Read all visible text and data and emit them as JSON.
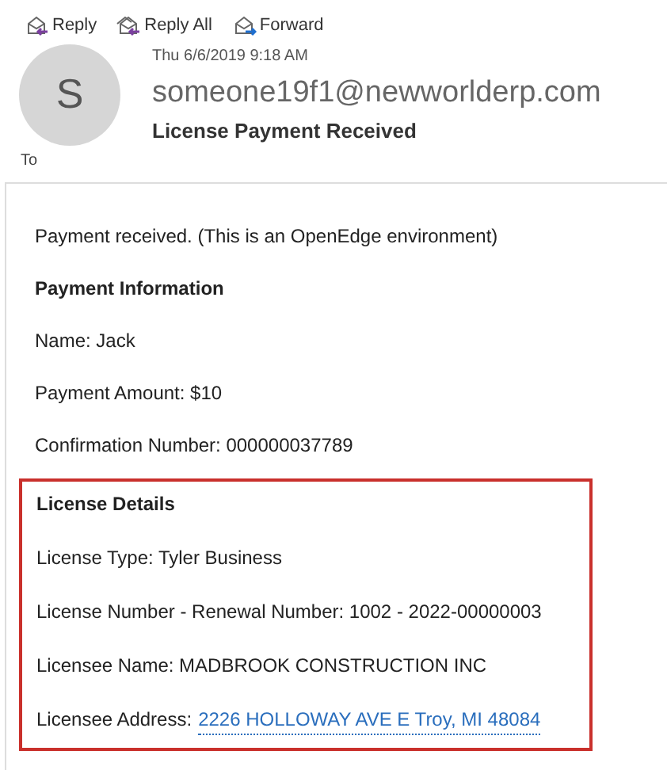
{
  "toolbar": [
    {
      "label": "Reply",
      "kind": "reply"
    },
    {
      "label": "Reply All",
      "kind": "reply_all"
    },
    {
      "label": "Forward",
      "kind": "forward"
    }
  ],
  "header": {
    "avatar_letter": "S",
    "date": "Thu 6/6/2019 9:18 AM",
    "sender": "someone19f1@newworlderp.com",
    "subject": "License Payment Received",
    "to_label": "To"
  },
  "body": [
    {
      "kind": "text",
      "text": "Payment received. (This is an OpenEdge environment)"
    },
    {
      "kind": "heading",
      "text": "Payment Information"
    },
    {
      "kind": "text",
      "text": "Name: Jack"
    },
    {
      "kind": "text",
      "text": "Payment Amount: $10"
    },
    {
      "kind": "text",
      "text": "Confirmation Number: 000000037789"
    }
  ],
  "highlighted_section": [
    {
      "kind": "heading",
      "text": "License Details"
    },
    {
      "kind": "text",
      "text": "License Type: Tyler Business"
    },
    {
      "kind": "text",
      "text": "License Number - Renewal Number: 1002 - 2022-00000003"
    },
    {
      "kind": "text",
      "text": "Licensee Name: MADBROOK CONSTRUCTION INC"
    },
    {
      "kind": "link",
      "label": "Licensee Address:",
      "link": "2226 HOLLOWAY AVE E Troy, MI 48084"
    }
  ]
}
